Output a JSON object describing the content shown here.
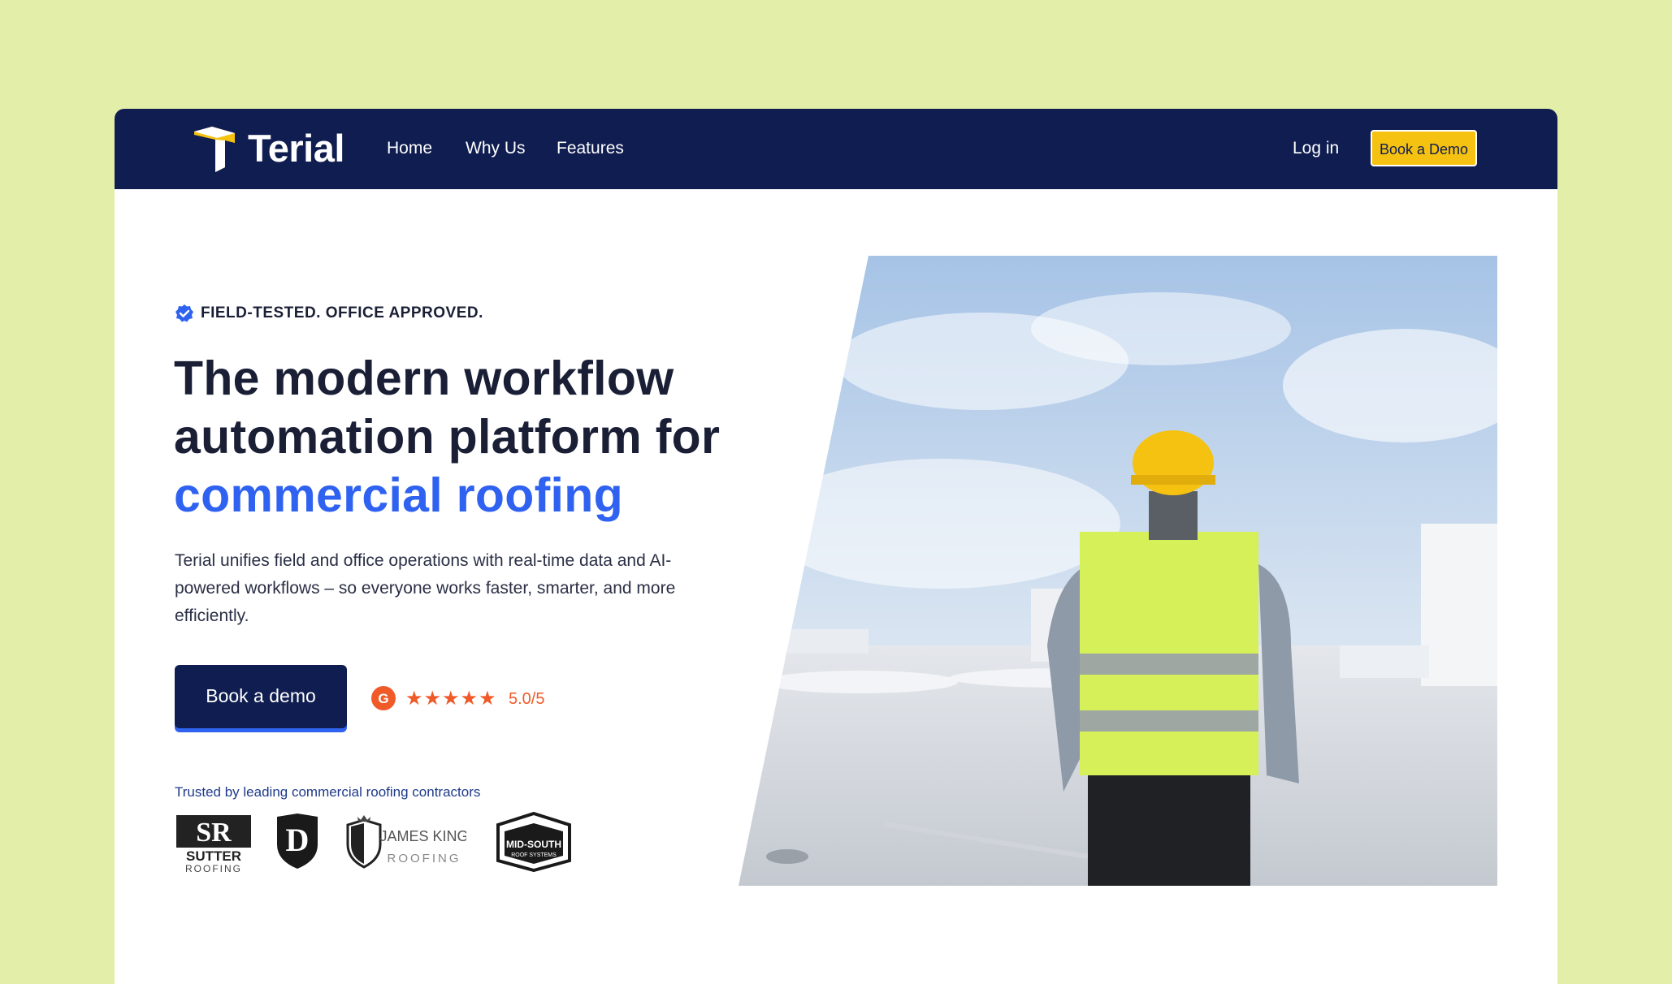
{
  "colors": {
    "page_bg": "#e3eea9",
    "nav_bg": "#0f1d50",
    "accent_blue": "#2f62f0",
    "cta_yellow": "#f6c211",
    "rating_orange": "#f05a28"
  },
  "nav": {
    "brand": "Terial",
    "links": [
      "Home",
      "Why Us",
      "Features"
    ],
    "login": "Log in",
    "cta": "Book a Demo"
  },
  "hero": {
    "eyebrow": "FIELD-TESTED. OFFICE APPROVED.",
    "eyebrow_icon": "verified-badge-icon",
    "headline_part1": "The modern workflow automation platform for ",
    "headline_accent": "commercial roofing",
    "subtext": "Terial unifies field and office operations with real-time data and AI-powered workflows – so everyone works faster, smarter, and more efficiently.",
    "cta": "Book a demo",
    "rating": {
      "icon": "g2-icon",
      "stars": 5,
      "text": "5.0/5"
    },
    "trusted_label": "Trusted by leading commercial roofing contractors",
    "clients": [
      {
        "name": "SUTTER",
        "sub": "ROOFING"
      },
      {
        "name": "D"
      },
      {
        "name": "JAMES KING",
        "sub": "ROOFING"
      },
      {
        "name": "MID-SOUTH",
        "sub": "ROOF SYSTEMS"
      }
    ],
    "image_description_icon": "roof-worker-photo"
  }
}
